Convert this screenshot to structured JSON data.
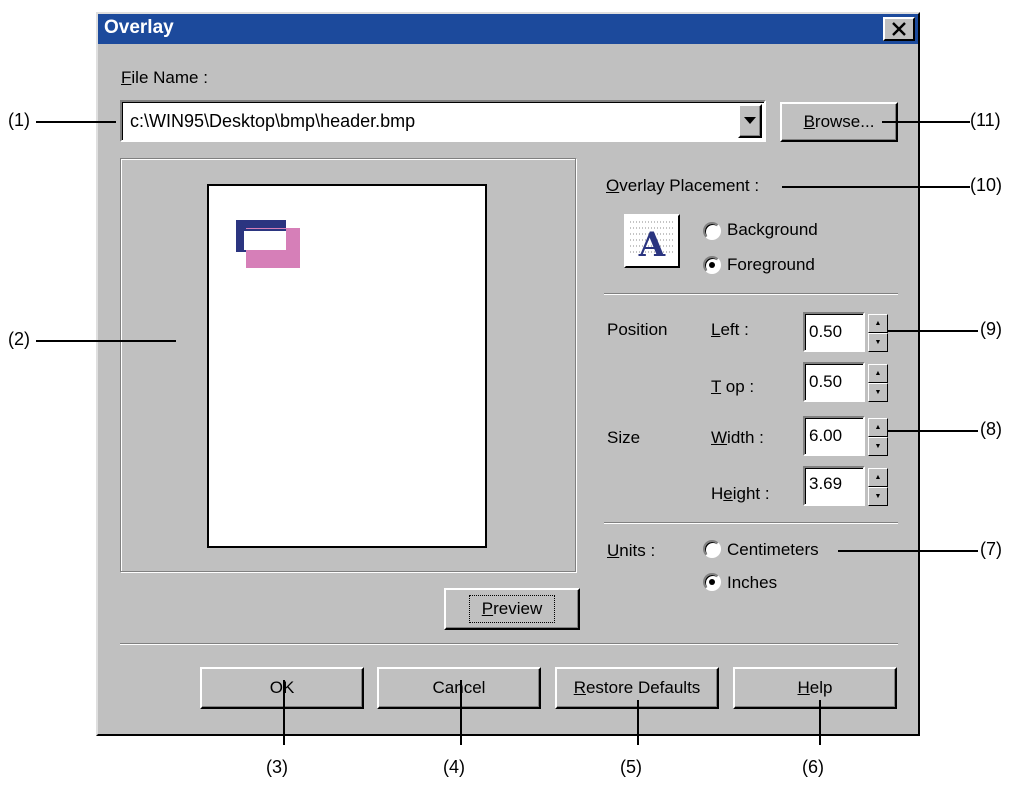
{
  "window": {
    "title": "Overlay"
  },
  "file": {
    "label_key": "F",
    "label_rest": "ile Name :",
    "value": "c:\\WIN95\\Desktop\\bmp\\header.bmp",
    "browse_key": "B",
    "browse_rest": "rowse..."
  },
  "placement": {
    "label_key": "O",
    "label_rest": "verlay Placement :",
    "options": [
      "Background",
      "Foreground"
    ],
    "selected": "Foreground"
  },
  "position": {
    "section_label": "Position",
    "left_key": "L",
    "left_rest": "eft :",
    "left_value": "0.50",
    "top_key": "T",
    "top_rest": " op :",
    "top_value": "0.50"
  },
  "size": {
    "section_label": "Size",
    "width_key": "W",
    "width_rest": "idth :",
    "width_value": "6.00",
    "height_pre": "H",
    "height_key": "e",
    "height_rest": "ight :",
    "height_value": "3.69"
  },
  "units": {
    "label_key": "U",
    "label_rest": "nits :",
    "options": [
      "Centimeters",
      "Inches"
    ],
    "selected": "Inches"
  },
  "buttons": {
    "preview_key": "P",
    "preview_rest": "review",
    "ok": "OK",
    "cancel": "Cancel",
    "restore_key": "R",
    "restore_rest": "estore Defaults",
    "help_key": "H",
    "help_rest": "elp"
  },
  "callouts": [
    "(1)",
    "(2)",
    "(3)",
    "(4)",
    "(5)",
    "(6)",
    "(7)",
    "(8)",
    "(9)",
    "(10)",
    "(11)"
  ],
  "colors": {
    "title_bar": "#1c4a9c",
    "overlay_dark": "#2b3580",
    "overlay_pink": "#d67fb8"
  }
}
